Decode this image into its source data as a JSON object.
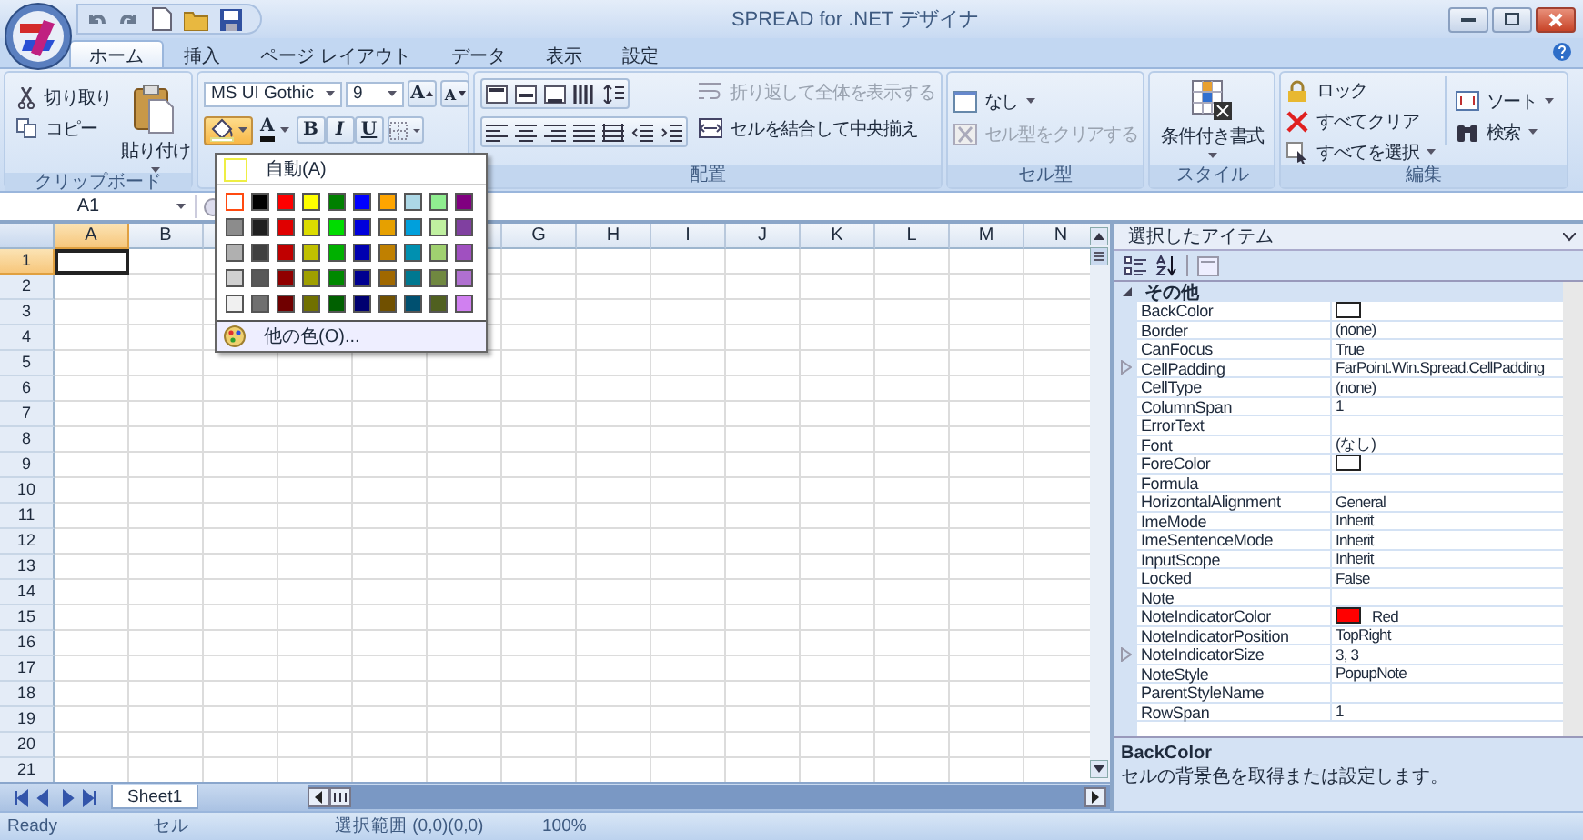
{
  "window": {
    "title": "SPREAD for .NET デザイナ"
  },
  "tabs": [
    {
      "label": "ホーム",
      "selected": true
    },
    {
      "label": "挿入",
      "selected": false
    },
    {
      "label": "ページ レイアウト",
      "selected": false
    },
    {
      "label": "データ",
      "selected": false
    },
    {
      "label": "表示",
      "selected": false
    },
    {
      "label": "設定",
      "selected": false
    }
  ],
  "ribbon": {
    "clipboard": {
      "label": "クリップボード",
      "cut": "切り取り",
      "copy": "コピー",
      "paste": "貼り付け"
    },
    "font": {
      "font_name": "MS UI Gothic",
      "font_size": "9",
      "grow": "A",
      "shrink": "A",
      "font_color": "A",
      "bold": "B",
      "italic": "I",
      "underline": "U",
      "fill_menu_open": true
    },
    "alignment": {
      "label": "配置",
      "wrap_text": {
        "label": "折り返して全体を表示する",
        "disabled": true
      },
      "merge_center": {
        "label": "セルを結合して中央揃え",
        "disabled": false
      }
    },
    "cell_type": {
      "label": "セル型",
      "type": {
        "label": "なし",
        "disabled": false
      },
      "clear": {
        "label": "セル型をクリアする",
        "disabled": true
      }
    },
    "style": {
      "label": "スタイル",
      "conditional": "条件付き書式"
    },
    "editing": {
      "label": "編集",
      "lock": "ロック",
      "clear_all": "すべてクリア",
      "select_all": "すべてを選択",
      "sort": "ソート",
      "find": "検索"
    }
  },
  "name_box": {
    "value": "A1"
  },
  "fill_color_menu": {
    "automatic": "自動(A)",
    "more_colors": "他の色(O)...",
    "swatches": [
      {
        "color": "#ffffff",
        "selected": true
      },
      {
        "color": "#000000",
        "selected": false
      },
      {
        "color": "#ff0000",
        "selected": false
      },
      {
        "color": "#ffff00",
        "selected": false
      },
      {
        "color": "#008000",
        "selected": false
      },
      {
        "color": "#0000ff",
        "selected": false
      },
      {
        "color": "#ffa500",
        "selected": false
      },
      {
        "color": "#add8e6",
        "selected": false
      },
      {
        "color": "#90ee90",
        "selected": false
      },
      {
        "color": "#800080",
        "selected": false
      },
      {
        "color": "#8c8c8c",
        "selected": false
      },
      {
        "color": "#202020",
        "selected": false
      },
      {
        "color": "#e00000",
        "selected": false
      },
      {
        "color": "#dcdc00",
        "selected": false
      },
      {
        "color": "#00dc00",
        "selected": false
      },
      {
        "color": "#0000dc",
        "selected": false
      },
      {
        "color": "#e6a000",
        "selected": false
      },
      {
        "color": "#00a0dc",
        "selected": false
      },
      {
        "color": "#c0f0a0",
        "selected": false
      },
      {
        "color": "#8040a0",
        "selected": false
      },
      {
        "color": "#b0b0b0",
        "selected": false
      },
      {
        "color": "#404040",
        "selected": false
      },
      {
        "color": "#c00000",
        "selected": false
      },
      {
        "color": "#c0c000",
        "selected": false
      },
      {
        "color": "#00b000",
        "selected": false
      },
      {
        "color": "#0000b0",
        "selected": false
      },
      {
        "color": "#c08000",
        "selected": false
      },
      {
        "color": "#0090b0",
        "selected": false
      },
      {
        "color": "#a0d070",
        "selected": false
      },
      {
        "color": "#a050c0",
        "selected": false
      },
      {
        "color": "#d0d0d0",
        "selected": false
      },
      {
        "color": "#585858",
        "selected": false
      },
      {
        "color": "#900000",
        "selected": false
      },
      {
        "color": "#a0a000",
        "selected": false
      },
      {
        "color": "#008800",
        "selected": false
      },
      {
        "color": "#000090",
        "selected": false
      },
      {
        "color": "#a06800",
        "selected": false
      },
      {
        "color": "#007890",
        "selected": false
      },
      {
        "color": "#708840",
        "selected": false
      },
      {
        "color": "#b070d0",
        "selected": false
      },
      {
        "color": "#f0f0f0",
        "selected": false
      },
      {
        "color": "#707070",
        "selected": false
      },
      {
        "color": "#700000",
        "selected": false
      },
      {
        "color": "#707000",
        "selected": false
      },
      {
        "color": "#006000",
        "selected": false
      },
      {
        "color": "#000070",
        "selected": false
      },
      {
        "color": "#705000",
        "selected": false
      },
      {
        "color": "#005070",
        "selected": false
      },
      {
        "color": "#506020",
        "selected": false
      },
      {
        "color": "#d080f0",
        "selected": false
      }
    ]
  },
  "grid": {
    "columns": [
      {
        "label": "A",
        "selected": true
      },
      {
        "label": "B",
        "selected": false
      },
      {
        "label": "G",
        "selected": false
      },
      {
        "label": "H",
        "selected": false
      },
      {
        "label": "I",
        "selected": false
      },
      {
        "label": "J",
        "selected": false
      },
      {
        "label": "K",
        "selected": false
      },
      {
        "label": "L",
        "selected": false
      },
      {
        "label": "M",
        "selected": false
      },
      {
        "label": "N",
        "selected": false
      }
    ],
    "rows": [
      {
        "label": "1",
        "selected": true
      },
      {
        "label": "2",
        "selected": false
      },
      {
        "label": "3",
        "selected": false
      },
      {
        "label": "4",
        "selected": false
      },
      {
        "label": "5",
        "selected": false
      },
      {
        "label": "6",
        "selected": false
      },
      {
        "label": "7",
        "selected": false
      },
      {
        "label": "8",
        "selected": false
      },
      {
        "label": "9",
        "selected": false
      },
      {
        "label": "10",
        "selected": false
      },
      {
        "label": "11",
        "selected": false
      },
      {
        "label": "12",
        "selected": false
      },
      {
        "label": "13",
        "selected": false
      },
      {
        "label": "14",
        "selected": false
      },
      {
        "label": "15",
        "selected": false
      },
      {
        "label": "16",
        "selected": false
      },
      {
        "label": "17",
        "selected": false
      },
      {
        "label": "18",
        "selected": false
      },
      {
        "label": "19",
        "selected": false
      },
      {
        "label": "20",
        "selected": false
      },
      {
        "label": "21",
        "selected": false
      }
    ]
  },
  "sheet_tabs": [
    {
      "label": "Sheet1",
      "selected": true
    }
  ],
  "properties": {
    "title": "選択したアイテム",
    "category": {
      "label": "その他",
      "expanded": true,
      "items": [
        {
          "name": "BackColor",
          "color": "#ffffff"
        },
        {
          "name": "Border",
          "value": "(none)"
        },
        {
          "name": "CanFocus",
          "value": "True"
        },
        {
          "name": "CellPadding",
          "value": "FarPoint.Win.Spread.CellPadding",
          "expanded": false
        },
        {
          "name": "CellType",
          "value": "(none)"
        },
        {
          "name": "ColumnSpan",
          "value": "1"
        },
        {
          "name": "ErrorText"
        },
        {
          "name": "Font",
          "value": "(なし)"
        },
        {
          "name": "ForeColor",
          "color": "#ffffff"
        },
        {
          "name": "Formula"
        },
        {
          "name": "HorizontalAlignment",
          "value": "General"
        },
        {
          "name": "ImeMode",
          "value": "Inherit"
        },
        {
          "name": "ImeSentenceMode",
          "value": "Inherit"
        },
        {
          "name": "InputScope",
          "value": "Inherit"
        },
        {
          "name": "Locked",
          "value": "False"
        },
        {
          "name": "Note"
        },
        {
          "name": "NoteIndicatorColor",
          "value": "Red",
          "color": "#ff0000"
        },
        {
          "name": "NoteIndicatorPosition",
          "value": "TopRight"
        },
        {
          "name": "NoteIndicatorSize",
          "value": "3, 3",
          "expanded": false
        },
        {
          "name": "NoteStyle",
          "value": "PopupNote"
        },
        {
          "name": "ParentStyleName"
        },
        {
          "name": "RowSpan",
          "value": "1"
        }
      ]
    },
    "description": {
      "title": "BackColor",
      "text": "セルの背景色を取得または設定します。"
    }
  },
  "status_bar": [
    "Ready",
    "セル",
    "選択範囲 (0,0)(0,0)",
    "100%"
  ]
}
